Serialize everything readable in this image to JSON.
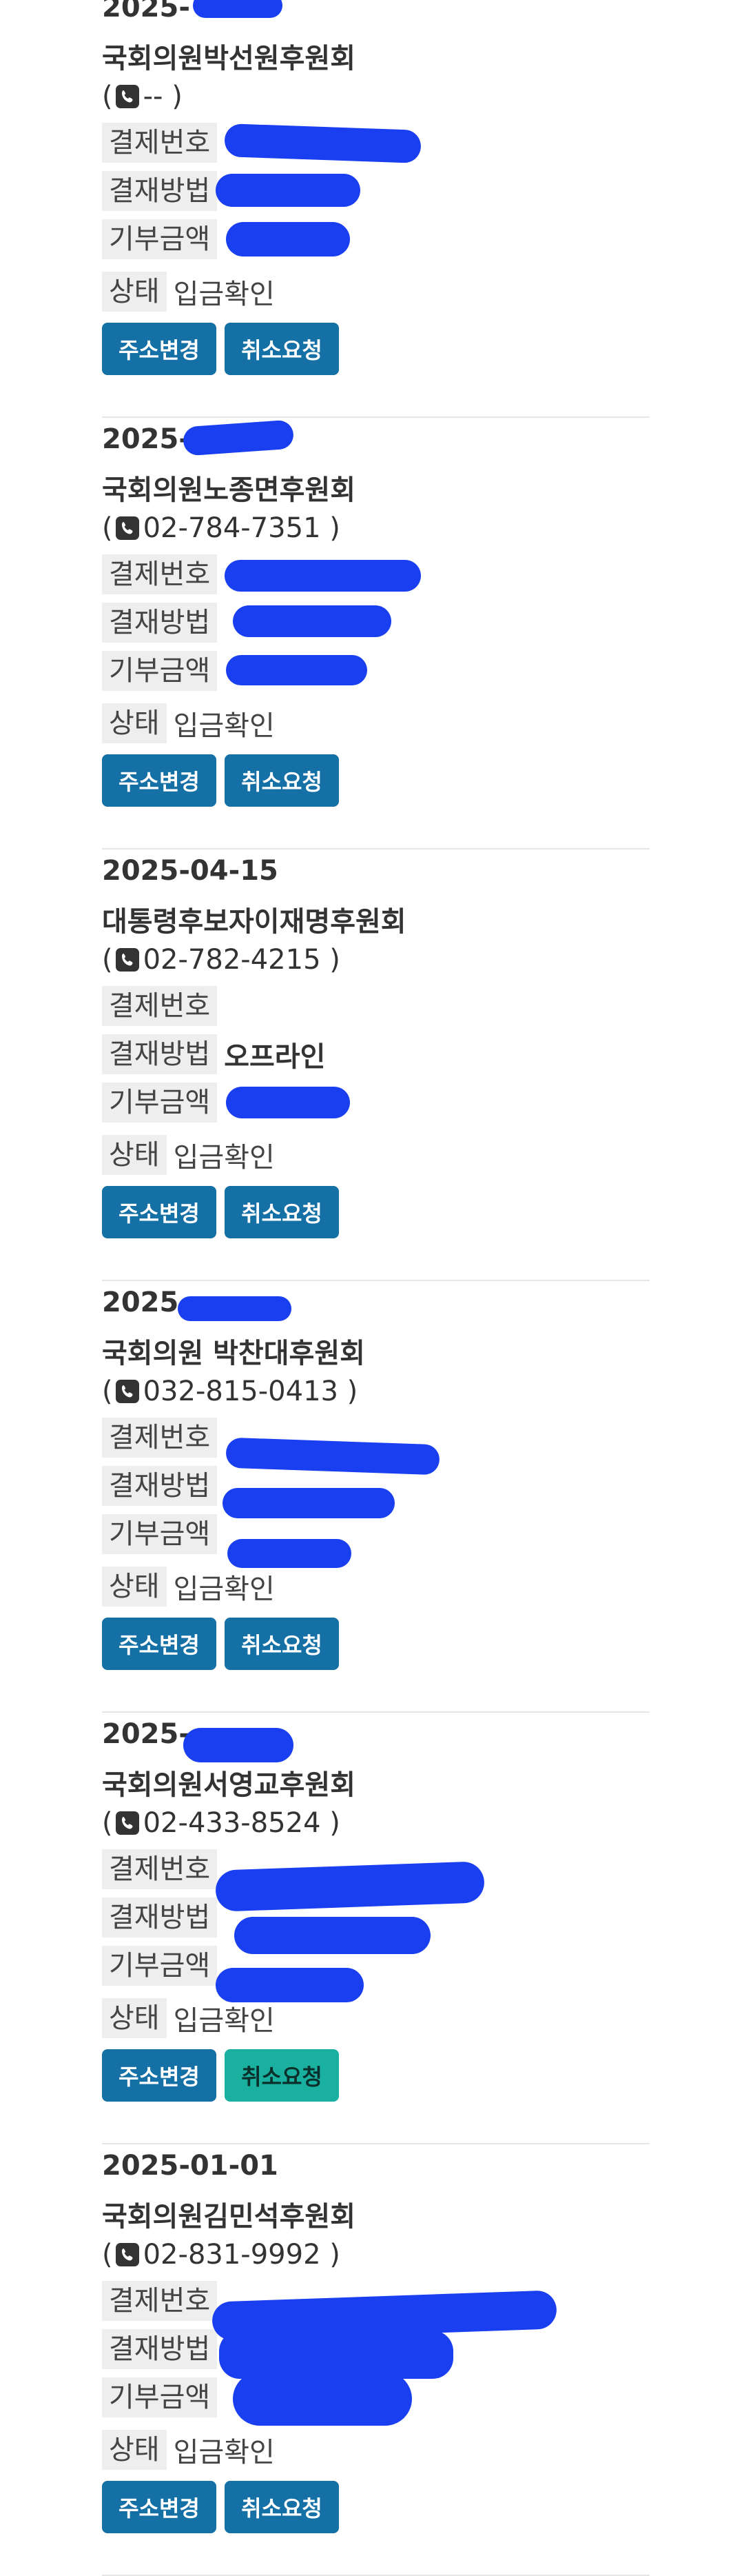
{
  "labels": {
    "payment_no": "결제번호",
    "payment_method": "결재방법",
    "amount": "기부금액",
    "status": "상태"
  },
  "buttons": {
    "change_address": "주소변경",
    "cancel_request": "취소요청"
  },
  "entries": [
    {
      "date": "2025-",
      "org": "국회의원박선원후원회",
      "phone": "--",
      "payment_no": "",
      "method": "",
      "amount": "",
      "status": "입금확인"
    },
    {
      "date": "2025-",
      "org": "국회의원노종면후원회",
      "phone": "02-784-7351",
      "payment_no": "",
      "method": "",
      "amount": "",
      "status": "입금확인"
    },
    {
      "date": "2025-04-15",
      "org": "대통령후보자이재명후원회",
      "phone": "02-782-4215",
      "payment_no": "",
      "method": "오프라인",
      "amount": "",
      "status": "입금확인"
    },
    {
      "date": "2025-",
      "org": "국회의원 박찬대후원회",
      "phone": "032-815-0413",
      "payment_no": "",
      "method": "",
      "amount": "",
      "status": "입금확인"
    },
    {
      "date": "2025-",
      "org": "국회의원서영교후원회",
      "phone": "02-433-8524",
      "payment_no": "",
      "method": "",
      "amount": "",
      "status": "입금확인"
    },
    {
      "date": "2025-01-01",
      "org": "국회의원김민석후원회",
      "phone": "02-831-9992",
      "payment_no": "",
      "method": "",
      "amount": "",
      "status": "입금확인"
    }
  ],
  "colors": {
    "button_primary": "#1570a6",
    "button_alt": "#1ab0a0",
    "redaction": "#1a3ff0",
    "label_bg": "#eeeeee"
  }
}
